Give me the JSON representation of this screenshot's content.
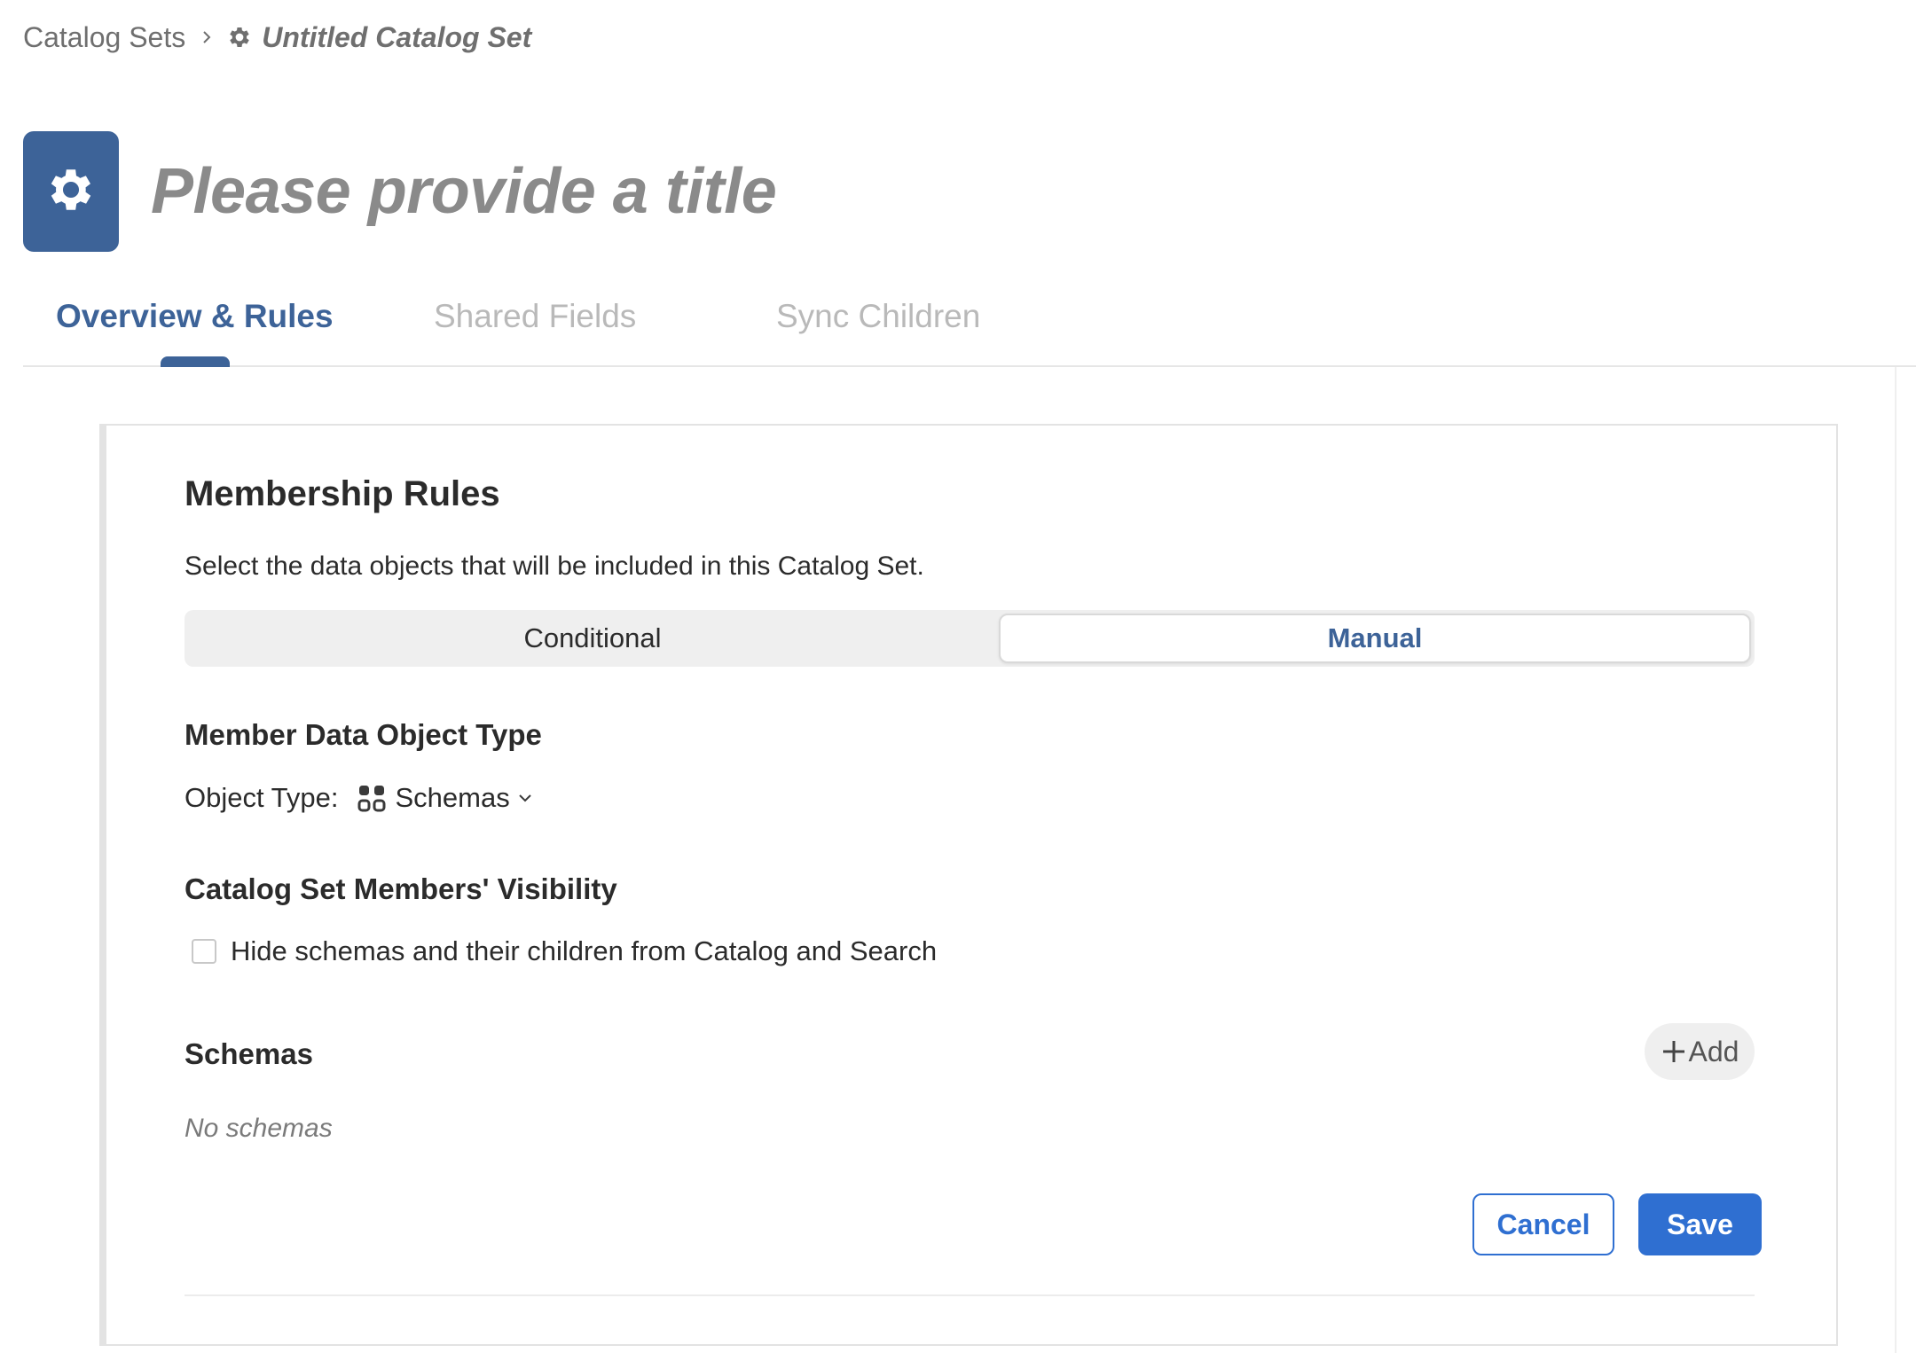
{
  "breadcrumb": {
    "parent": "Catalog Sets",
    "current": "Untitled Catalog Set"
  },
  "header": {
    "icon": "gear-icon",
    "title_placeholder": "Please provide a title"
  },
  "tabs": [
    {
      "label": "Overview & Rules",
      "active": true
    },
    {
      "label": "Shared Fields",
      "active": false
    },
    {
      "label": "Sync Children",
      "active": false
    }
  ],
  "membership": {
    "heading": "Membership Rules",
    "description": "Select the data objects that will be included in this Catalog Set.",
    "modes": [
      {
        "label": "Conditional",
        "selected": false
      },
      {
        "label": "Manual",
        "selected": true
      }
    ],
    "object_type_heading": "Member Data Object Type",
    "object_type_label": "Object Type:",
    "object_type_value": "Schemas",
    "visibility_heading": "Catalog Set Members' Visibility",
    "hide_checkbox_label": "Hide schemas and their children from Catalog and Search",
    "hide_checked": false,
    "schemas_heading": "Schemas",
    "add_label": "Add",
    "empty_text": "No schemas"
  },
  "actions": {
    "cancel_label": "Cancel",
    "save_label": "Save"
  },
  "colors": {
    "brand": "#3d6398",
    "primary_button": "#2f6fd1",
    "muted_text": "#8a8a8a"
  }
}
